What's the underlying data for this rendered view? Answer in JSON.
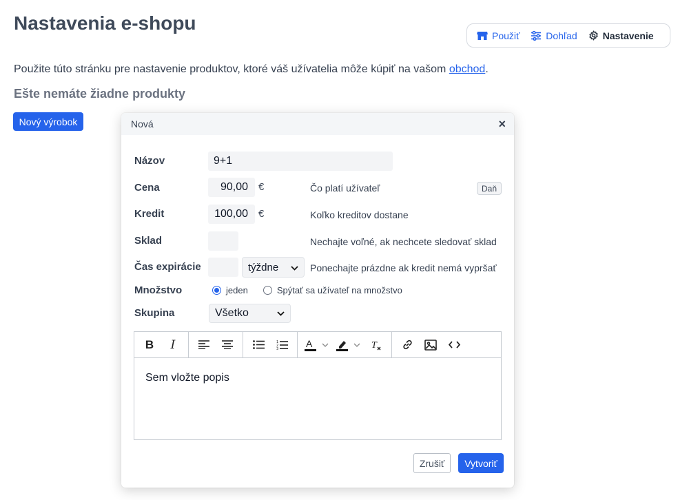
{
  "page": {
    "title": "Nastavenia e-shopu",
    "intro_text": "Použite túto stránku pre nastavenie produktov, ktoré váš užívatelia môže kúpiť na vašom ",
    "intro_link": "obchod",
    "intro_end": ".",
    "empty_heading": "Ešte nemáte žiadne produkty",
    "new_product_button": "Nový výrobok"
  },
  "nav": {
    "items": [
      {
        "label": "Použiť",
        "icon": "store-icon",
        "active": false
      },
      {
        "label": "Dohľad",
        "icon": "sliders-icon",
        "active": false
      },
      {
        "label": "Nastavenie",
        "icon": "gear-icon",
        "active": true
      }
    ]
  },
  "dialog": {
    "title": "Nová",
    "close_icon": "×",
    "labels": {
      "name": "Názov",
      "price": "Cena",
      "credit": "Kredit",
      "stock": "Sklad",
      "expiry": "Čas expirácie",
      "quantity": "Množstvo",
      "group": "Skupina"
    },
    "fields": {
      "name": "9+1",
      "price": "90,00",
      "credit": "100,00",
      "stock": "",
      "expiry": "",
      "expiry_unit": "týždne",
      "group": "Všetko"
    },
    "currency": "€",
    "hints": {
      "price": "Čo platí užívateľ",
      "credit": "Koľko kreditov dostane",
      "stock": "Nechajte voľné, ak nechcete sledovať sklad",
      "expiry": "Ponechajte prázdne ak kredit nemá vypršať"
    },
    "tax_button": "Daň",
    "quantity_options": [
      {
        "label": "jeden",
        "selected": true
      },
      {
        "label": "Spýtať sa užívateľ na množstvo",
        "selected": false
      }
    ],
    "editor": {
      "toolbar_icons": [
        "bold-icon",
        "italic-icon",
        "align-left-icon",
        "align-center-icon",
        "bullet-list-icon",
        "numbered-list-icon",
        "text-color-icon",
        "highlight-icon",
        "clear-format-icon",
        "link-icon",
        "image-icon",
        "code-icon"
      ],
      "placeholder": "Sem vložte popis"
    },
    "cancel_button": "Zrušiť",
    "create_button": "Vytvoriť"
  },
  "colors": {
    "accent": "#2563eb",
    "title": "#3f4a5a",
    "field_bg": "#f3f4f6"
  }
}
